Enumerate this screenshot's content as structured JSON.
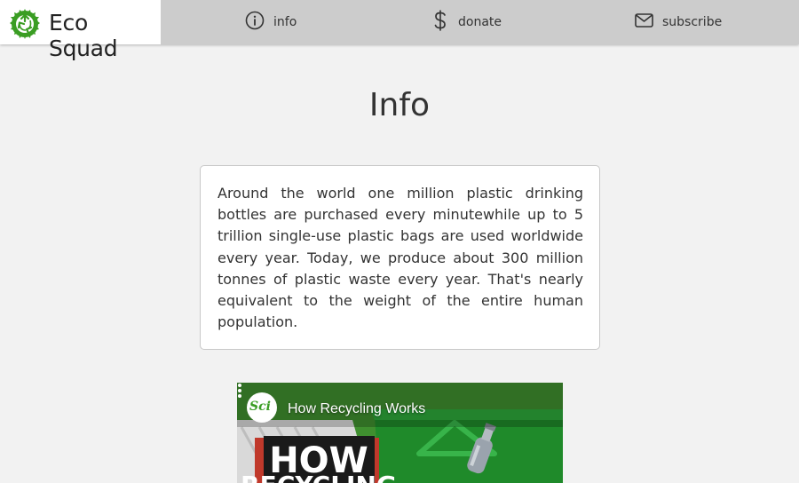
{
  "brand": {
    "name": "Eco Squad",
    "logo_icon": "recycle-leaf-logo"
  },
  "nav": [
    {
      "label": "info",
      "icon": "info-circle-icon"
    },
    {
      "label": "donate",
      "icon": "dollar-icon"
    },
    {
      "label": "subscribe",
      "icon": "envelope-icon"
    }
  ],
  "main": {
    "title": "Info",
    "paragraph": "Around the world one million plastic drinking bottles are purchased every minutewhile up to 5 trillion single-use plastic bags are used worldwide every year. Today, we produce about 300 million tonnes of plastic waste every year. That's nearly equivalent to the weight of the entire human population."
  },
  "video": {
    "title": "How Recycling Works",
    "thumbnail_text_line1": "HOW",
    "thumbnail_text_line2": "RECYCLING",
    "channel_icon_text": "Sci"
  },
  "colors": {
    "header_bg": "#cccccc",
    "page_bg": "#f2f2f2",
    "brand_green": "#3a9d23",
    "video_green": "#2d8a2d"
  }
}
